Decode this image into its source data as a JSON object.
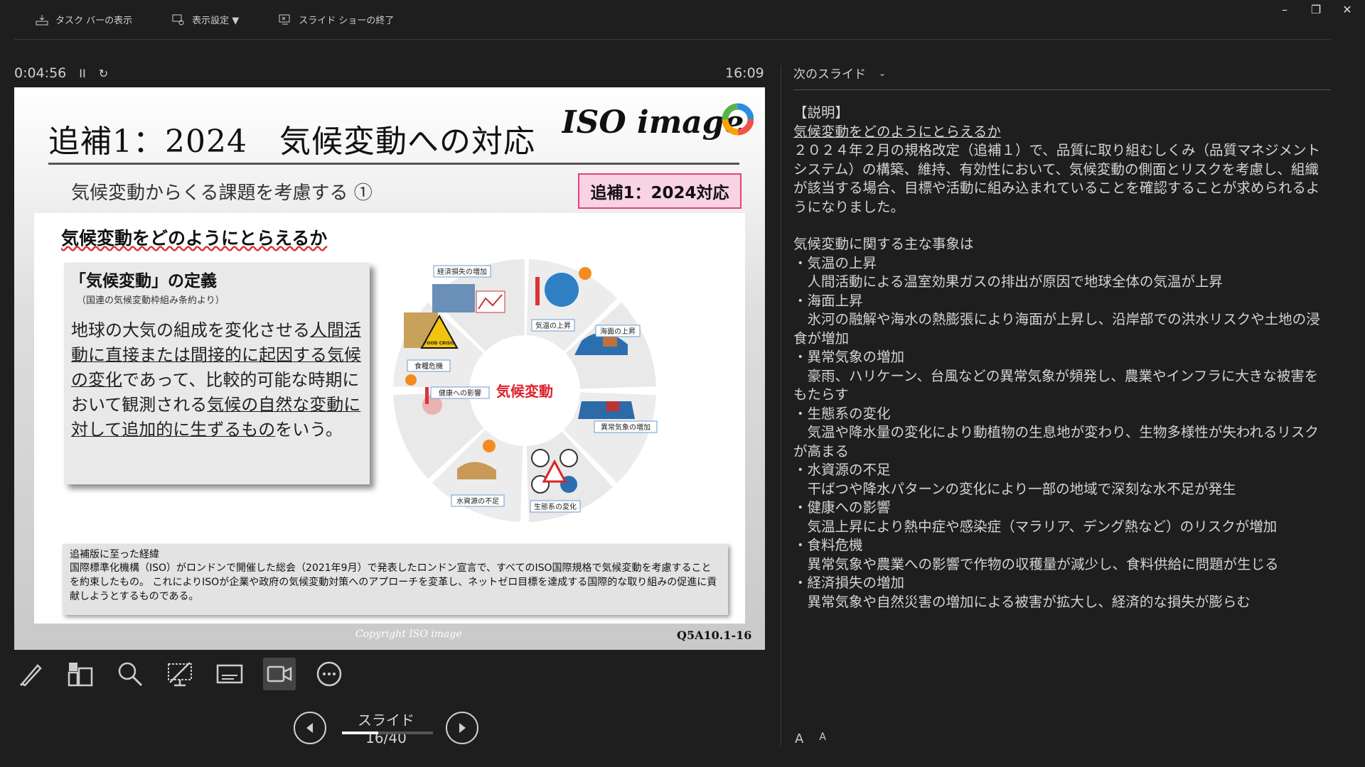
{
  "window_controls": [
    "–",
    "❐",
    "✕"
  ],
  "toolbar": {
    "taskbar_label": "タスク バーの表示",
    "display_label": "表示設定 ▼",
    "end_label": "スライド ショーの終了"
  },
  "timer": {
    "elapsed": "0:04:56",
    "pause": "II",
    "reset": "↻"
  },
  "clock": "16:09",
  "slide": {
    "title": "追補1：2024　気候変動への対応",
    "subtitle": "気候変動からくる課題を考慮する ①",
    "badge": "追補1：2024対応",
    "logo_text": "ISO image",
    "question": "気候変動をどのようにとらえるか",
    "definition": {
      "title": "「気候変動」の定義",
      "source": "（国連の気候変動枠組み条約より）",
      "text_parts": [
        {
          "t": "地球の大気の組成を変化させる",
          "u": false
        },
        {
          "t": "人間活動に直接または間接的に起因する気候の変化",
          "u": true
        },
        {
          "t": "であって、比較的可能な時期において観測される",
          "u": false
        },
        {
          "t": "気候の自然な変動に対して追加的に生ずるもの",
          "u": true
        },
        {
          "t": "をいう。",
          "u": false
        }
      ]
    },
    "wheel": {
      "center": "気候変動",
      "labels": [
        "経済損失の増加",
        "気温の上昇",
        "海面の上昇",
        "異常気象の増加",
        "生態系の変化",
        "水資源の不足",
        "健康への影響",
        "食糧危機"
      ],
      "food_crisis_sign": "FOOD CRISIS"
    },
    "history": {
      "title": "追補版に至った経緯",
      "body": "国際標準化機構（ISO）がロンドンで開催した総会（2021年9月）で発表したロンドン宣言で、すべてのISO国際規格で気候変動を考慮することを約束したもの。 これによりISOが企業や政府の気候変動対策へのアプローチを変革し、ネットゼロ目標を達成する国際的な取り組みの促進に貢献しようとするものである。"
    },
    "copyright": "Copyright  ISO image",
    "code": "Q5A10.1-16"
  },
  "tools": [
    "pen-tool",
    "see-all-slides",
    "zoom-into-slide",
    "black-screen",
    "subtitles",
    "camera",
    "more-options"
  ],
  "nav": {
    "label": "スライド 16/40",
    "current": 16,
    "total": 40,
    "progress": 0.4
  },
  "next_slide_label": "次のスライド",
  "notes": {
    "bracket": "【説明】",
    "heading": "気候変動をどのようにとらえるか",
    "intro": "２０２４年２月の規格改定（追補１）で、品質に取り組むしくみ（品質マネジメントシステム）の構築、維持、有効性において、気候変動の側面とリスクを考慮し、組織が該当する場合、目標や活動に組み込まれていることを確認することが求められるようになりました。",
    "list_title": "気候変動に関する主な事象は",
    "items": [
      {
        "name": "・気温の上昇",
        "desc": "　人間活動による温室効果ガスの排出が原因で地球全体の気温が上昇"
      },
      {
        "name": "・海面上昇",
        "desc": "　氷河の融解や海水の熱膨張により海面が上昇し、沿岸部での洪水リスクや土地の浸食が増加"
      },
      {
        "name": "・異常気象の増加",
        "desc": "　豪雨、ハリケーン、台風などの異常気象が頻発し、農業やインフラに大きな被害をもたらす"
      },
      {
        "name": "・生態系の変化",
        "desc": "　気温や降水量の変化により動植物の生息地が変わり、生物多様性が失われるリスクが高まる"
      },
      {
        "name": "・水資源の不足",
        "desc": "　干ばつや降水パターンの変化により一部の地域で深刻な水不足が発生"
      },
      {
        "name": "・健康への影響",
        "desc": "　気温上昇により熱中症や感染症（マラリア、デング熱など）のリスクが増加"
      },
      {
        "name": "・食料危機",
        "desc": "　異常気象や農業への影響で作物の収穫量が減少し、食料供給に問題が生じる"
      },
      {
        "name": "・経済損失の増加",
        "desc": "　異常気象や自然災害の増加による被害が拡大し、経済的な損失が膨らむ"
      }
    ]
  },
  "font_buttons": [
    "A",
    "A"
  ]
}
